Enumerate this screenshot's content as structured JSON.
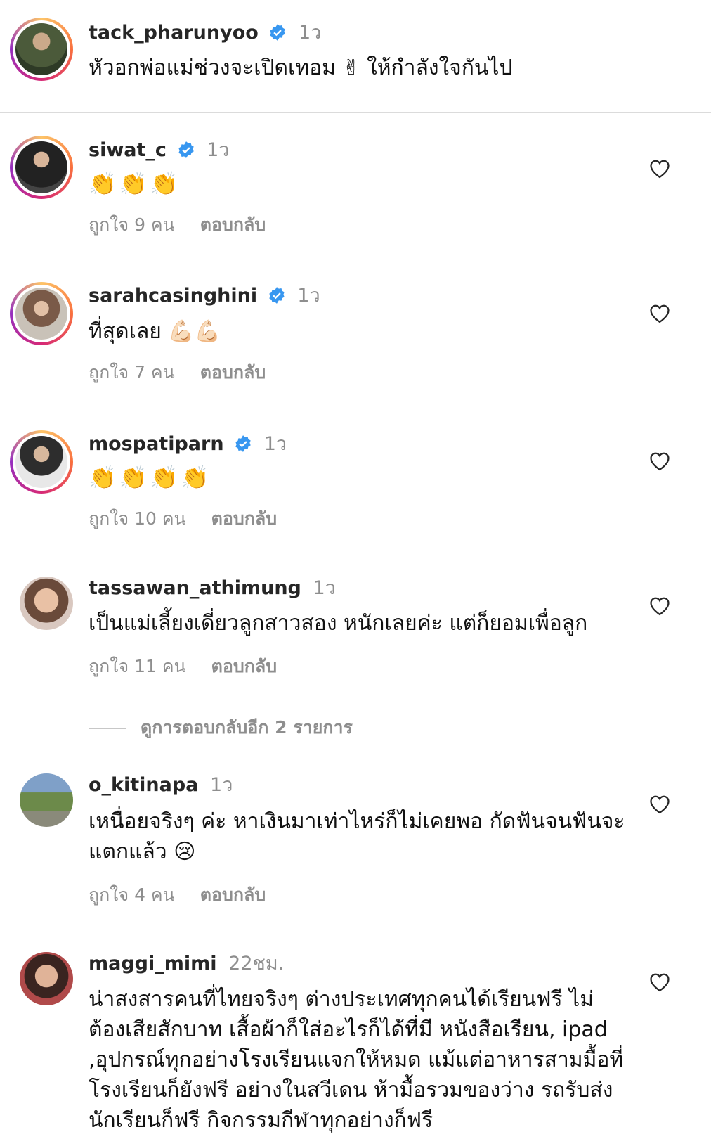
{
  "comments": [
    {
      "username": "tack_pharunyoo",
      "time": "1ว",
      "text": "หัวอกพ่อแม่ช่วงจะเปิดเทอม ✌ ให้กำลังใจกันไป",
      "likes": "",
      "reply": ""
    },
    {
      "username": "siwat_c",
      "time": "1ว",
      "text": "👏👏👏",
      "likes": "ถูกใจ 9 คน",
      "reply": "ตอบกลับ"
    },
    {
      "username": "sarahcasinghini",
      "time": "1ว",
      "text": "ที่สุดเลย 💪🏻💪🏻",
      "likes": "ถูกใจ 7 คน",
      "reply": "ตอบกลับ"
    },
    {
      "username": "mospatiparn",
      "time": "1ว",
      "text": "👏👏👏👏",
      "likes": "ถูกใจ 10 คน",
      "reply": "ตอบกลับ"
    },
    {
      "username": "tassawan_athimung",
      "time": "1ว",
      "text": "เป็นแม่เลี้ยงเดี่ยวลูกสาวสอง หนักเลยค่ะ แต่ก็ยอมเพื่อลูก",
      "likes": "ถูกใจ 11 คน",
      "reply": "ตอบกลับ"
    },
    {
      "username": "o_kitinapa",
      "time": "1ว",
      "text": "เหนื่อยจริงๆ ค่ะ หาเงินมาเท่าไหร่ก็ไม่เคยพอ กัดฟันจนฟันจะแตกแล้ว 😢",
      "likes": "ถูกใจ 4 คน",
      "reply": "ตอบกลับ"
    },
    {
      "username": "maggi_mimi",
      "time": "22ชม.",
      "text": "น่าสงสารคนที่ไทยจริงๆ ต่างประเทศทุกคนได้เรียนฟรี ไม่ต้องเสียสักบาท เสื้อผ้าก็ใส่อะไรก็ได้ที่มี หนังสือเรียน, ipad ,อุปกรณ์ทุกอย่างโรงเรียนแจกให้หมด แม้แต่อาหารสามมื้อที่โรงเรียนก็ยังฟรี อย่างในสวีเดน ห้ามื้อรวมของว่าง รถรับส่งนักเรียนก็ฟรี กิจกรรมกีฬาทุกอย่างก็ฟรี",
      "likes": "",
      "reply": ""
    }
  ],
  "view_replies": "ดูการตอบกลับอีก 2 รายการ",
  "icons": {
    "verified": "verified-badge-icon",
    "heart": "heart-icon"
  },
  "colors": {
    "verified": "#3897f0",
    "secondary_text": "#8e8e8e"
  }
}
